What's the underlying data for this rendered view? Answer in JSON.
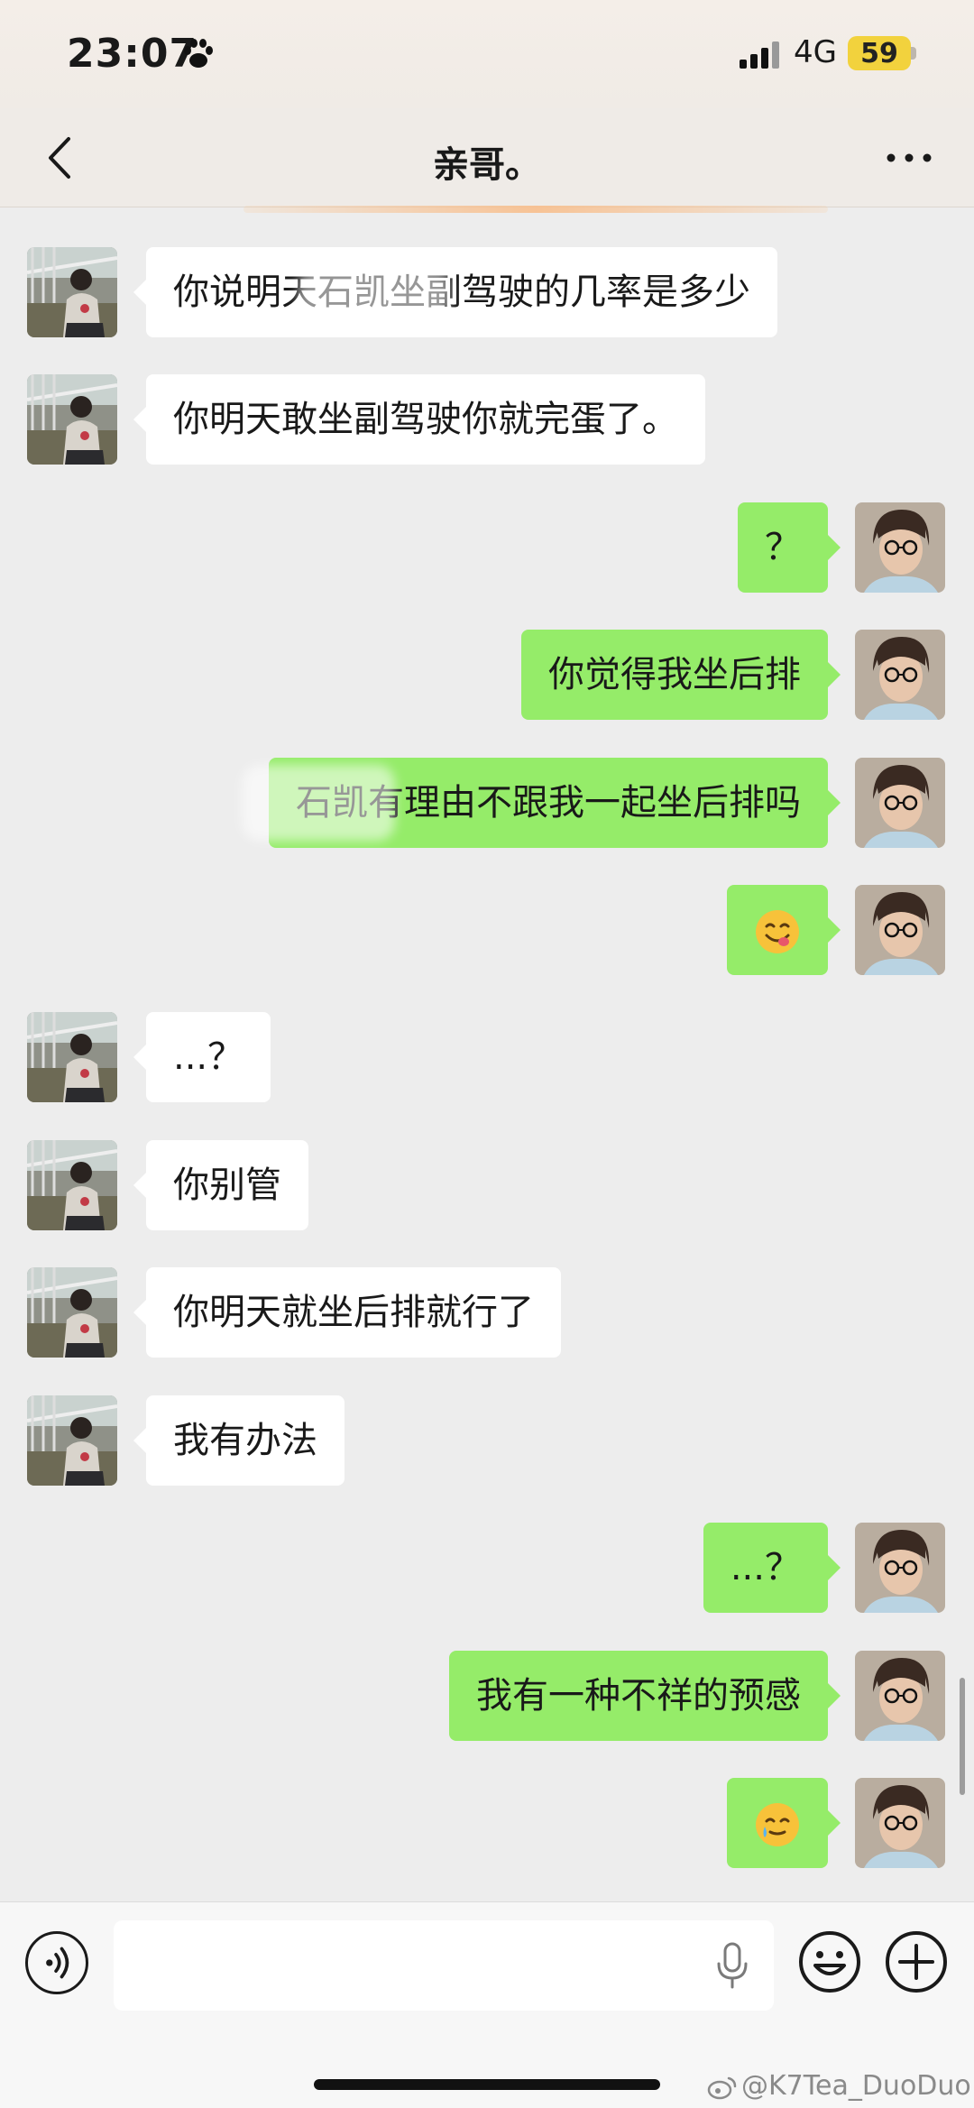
{
  "status_bar": {
    "time": "23:07",
    "network": "4G",
    "battery": "59"
  },
  "header": {
    "title": "亲哥。"
  },
  "messages": [
    {
      "side": "left",
      "text": "你说明天石凯坐副驾驶的几率是多少"
    },
    {
      "side": "left",
      "text": "你明天敢坐副驾驶你就完蛋了。"
    },
    {
      "side": "right",
      "text": "？"
    },
    {
      "side": "right",
      "text": "你觉得我坐后排"
    },
    {
      "side": "right",
      "text": "石凯有理由不跟我一起坐后排吗"
    },
    {
      "side": "right",
      "text": "",
      "emoji": "yum-face-emoji"
    },
    {
      "side": "left",
      "text": "...？"
    },
    {
      "side": "left",
      "text": "你别管"
    },
    {
      "side": "left",
      "text": "你明天就坐后排就行了"
    },
    {
      "side": "left",
      "text": "我有办法"
    },
    {
      "side": "right",
      "text": "...？"
    },
    {
      "side": "right",
      "text": "我有一种不祥的预感"
    },
    {
      "side": "right",
      "text": "",
      "emoji": "teary-smile-emoji"
    }
  ],
  "watermark": "@K7Tea_DuoDuo",
  "colors": {
    "self_bubble": "#95ec69",
    "other_bubble": "#ffffff",
    "background": "#ededed",
    "battery": "#f2d23d"
  },
  "icons": [
    "paw-icon",
    "signal-icon",
    "back-icon",
    "more-icon",
    "voice-icon",
    "microphone-icon",
    "emoji-icon",
    "plus-icon",
    "weibo-icon"
  ]
}
